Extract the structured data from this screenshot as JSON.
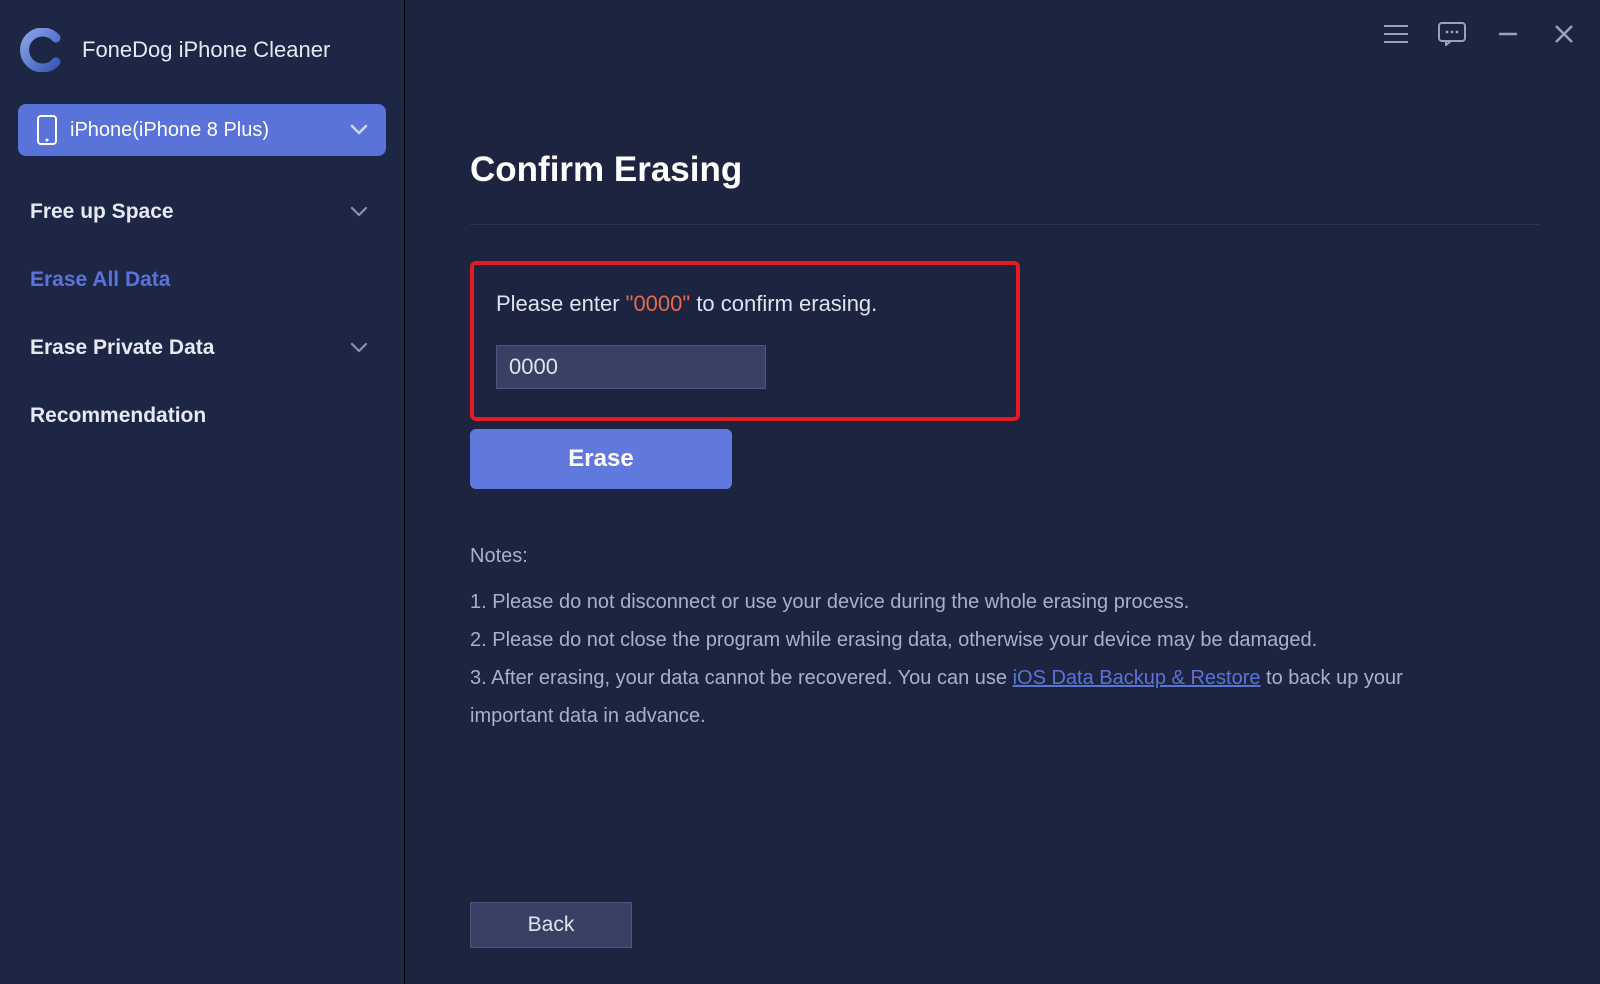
{
  "brand": {
    "title": "FoneDog iPhone Cleaner"
  },
  "device": {
    "label": "iPhone(iPhone 8 Plus)"
  },
  "nav": {
    "free_up": "Free up Space",
    "erase_all": "Erase All Data",
    "erase_private": "Erase Private Data",
    "recommendation": "Recommendation"
  },
  "page": {
    "title": "Confirm Erasing",
    "prompt_prefix": "Please enter ",
    "prompt_code": "\"0000\"",
    "prompt_suffix": " to confirm erasing.",
    "input_value": "0000",
    "erase_label": "Erase",
    "back_label": "Back"
  },
  "notes": {
    "heading": "Notes:",
    "n1": "1. Please do not disconnect or use your device during the whole erasing process.",
    "n2": "2. Please do not close the program while erasing data, otherwise your device may be damaged.",
    "n3a": "3. After erasing, your data cannot be recovered. You can use ",
    "n3link": "iOS Data Backup & Restore",
    "n3b": " to back up your important data in advance."
  }
}
